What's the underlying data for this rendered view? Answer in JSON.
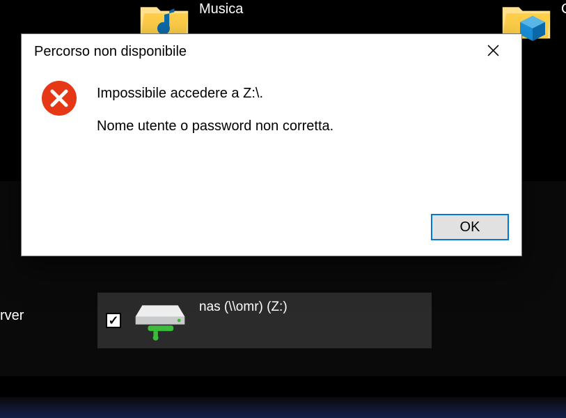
{
  "explorer": {
    "folders": {
      "music": {
        "label": "Musica"
      },
      "right_partial": {
        "label": "C"
      }
    },
    "sidebar_partial_label": "rver",
    "network_drive": {
      "checked": true,
      "label": "nas (\\\\omr) (Z:)"
    }
  },
  "dialog": {
    "title": "Percorso non disponibile",
    "message_primary": "Impossibile accedere a Z:\\.",
    "message_secondary": "Nome utente o password non corretta.",
    "ok_label": "OK"
  }
}
